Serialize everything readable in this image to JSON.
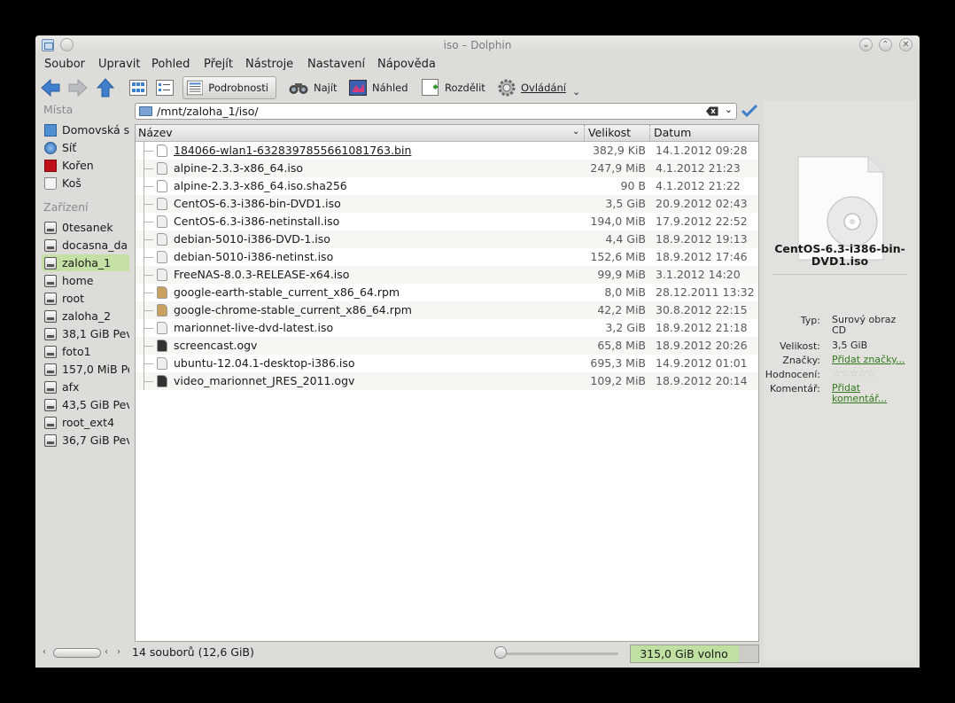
{
  "window": {
    "title": "iso – Dolphin"
  },
  "menu": [
    "Soubor",
    "Upravit",
    "Pohled",
    "Přejít",
    "Nástroje",
    "Nastavení",
    "Nápověda"
  ],
  "toolbar": {
    "details_label": "Podrobnosti",
    "find_label": "Najít",
    "preview_label": "Náhled",
    "split_label": "Rozdělit",
    "control_label": "Ovládání"
  },
  "sidebar": {
    "places_heading": "Místa",
    "places": [
      "Domovská s",
      "Síť",
      "Kořen",
      "Koš"
    ],
    "devices_heading": "Zařízení",
    "devices": [
      "0tesanek",
      "docasna_da",
      "zaloha_1",
      "home",
      "root",
      "zaloha_2",
      "38,1 GiB Pev",
      "foto1",
      "157,0 MiB Pe",
      "afx",
      "43,5 GiB Pev",
      "root_ext4",
      "36,7 GiB Pev"
    ],
    "active_device": "zaloha_1"
  },
  "location": {
    "path": "/mnt/zaloha_1/iso/"
  },
  "columns": {
    "name": "Název",
    "size": "Velikost",
    "date": "Datum"
  },
  "files": [
    {
      "name": "184066-wlan1-6328397855661081763.bin",
      "size": "382,9 KiB",
      "date": "14.1.2012 09:28",
      "icon": "binary-file-icon"
    },
    {
      "name": "alpine-2.3.3-x86_64.iso",
      "size": "247,9 MiB",
      "date": "4.1.2012 21:23",
      "icon": "disc-image-icon"
    },
    {
      "name": "alpine-2.3.3-x86_64.iso.sha256",
      "size": "90 B",
      "date": "4.1.2012 21:22",
      "icon": "text-file-icon"
    },
    {
      "name": "CentOS-6.3-i386-bin-DVD1.iso",
      "size": "3,5 GiB",
      "date": "20.9.2012 02:43",
      "icon": "disc-image-icon"
    },
    {
      "name": "CentOS-6.3-i386-netinstall.iso",
      "size": "194,0 MiB",
      "date": "17.9.2012 22:52",
      "icon": "disc-image-icon"
    },
    {
      "name": "debian-5010-i386-DVD-1.iso",
      "size": "4,4 GiB",
      "date": "18.9.2012 19:13",
      "icon": "disc-image-icon"
    },
    {
      "name": "debian-5010-i386-netinst.iso",
      "size": "152,6 MiB",
      "date": "18.9.2012 17:46",
      "icon": "disc-image-icon"
    },
    {
      "name": "FreeNAS-8.0.3-RELEASE-x64.iso",
      "size": "99,9 MiB",
      "date": "3.1.2012 14:20",
      "icon": "disc-image-icon"
    },
    {
      "name": "google-earth-stable_current_x86_64.rpm",
      "size": "8,0 MiB",
      "date": "28.12.2011 13:32",
      "icon": "rpm-package-icon"
    },
    {
      "name": "google-chrome-stable_current_x86_64.rpm",
      "size": "42,2 MiB",
      "date": "30.8.2012 22:15",
      "icon": "rpm-package-icon"
    },
    {
      "name": "marionnet-live-dvd-latest.iso",
      "size": "3,2 GiB",
      "date": "18.9.2012 21:18",
      "icon": "disc-image-icon"
    },
    {
      "name": "screencast.ogv",
      "size": "65,8 MiB",
      "date": "18.9.2012 20:26",
      "icon": "video-file-icon"
    },
    {
      "name": "ubuntu-12.04.1-desktop-i386.iso",
      "size": "695,3 MiB",
      "date": "14.9.2012 01:01",
      "icon": "disc-image-icon"
    },
    {
      "name": "video_marionnet_JRES_2011.ogv",
      "size": "109,2 MiB",
      "date": "18.9.2012 20:14",
      "icon": "video-file-icon"
    }
  ],
  "info": {
    "filename": "CentOS-6.3-i386-bin-DVD1.iso",
    "type_label": "Typ:",
    "type_value": "Surový obraz CD",
    "size_label": "Velikost:",
    "size_value": "3,5 GiB",
    "tags_label": "Značky:",
    "tags_value": "Přidat značky...",
    "rating_label": "Hodnocení:",
    "rating_value": 0,
    "rating_max": 5,
    "comment_label": "Komentář:",
    "comment_value": "Přidat komentář..."
  },
  "status": {
    "summary": "14 souborů (12,6 GiB)",
    "free_space": "315,0 GiB volno",
    "free_fraction": 0.85
  },
  "colors": {
    "active_highlight": "#c5e0a5",
    "link": "#2f7a1e"
  }
}
